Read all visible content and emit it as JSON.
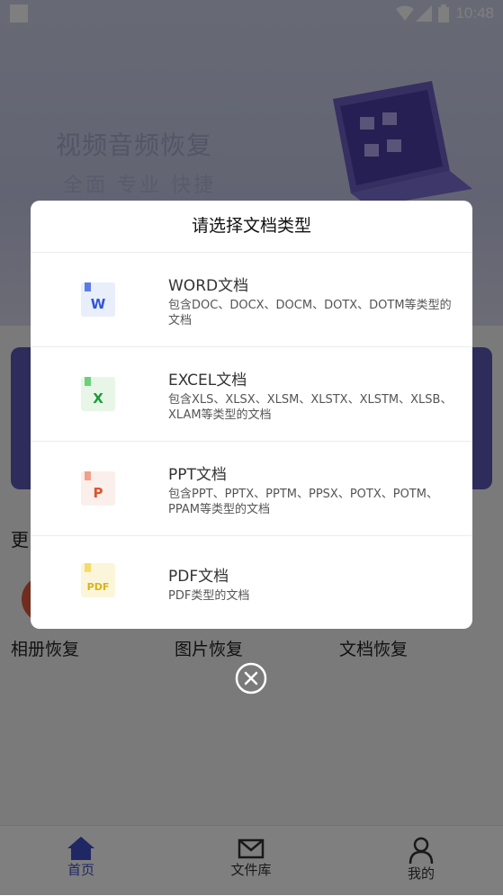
{
  "status_bar": {
    "time": "10:48"
  },
  "hero": {
    "title": "视频音频恢复",
    "subtitle": "全面  专业  快捷"
  },
  "section": {
    "more_label": "更"
  },
  "functions": [
    "相册恢复",
    "图片恢复",
    "文档恢复"
  ],
  "tabs": [
    {
      "label": "首页",
      "icon": "home-icon",
      "active": true
    },
    {
      "label": "文件库",
      "icon": "mail-icon",
      "active": false
    },
    {
      "label": "我的",
      "icon": "user-icon",
      "active": false
    }
  ],
  "dialog": {
    "title": "请选择文档类型",
    "options": [
      {
        "name": "WORD文档",
        "desc": "包含DOC、DOCX、DOCM、DOTX、DOTM等类型的文档",
        "icon_letter": "W",
        "icon": "word-file-icon",
        "icon_bg": "#e9eefb",
        "letter_color": "#2f56d8",
        "flag_color": "#5b7be6"
      },
      {
        "name": "EXCEL文档",
        "desc": "包含XLS、XLSX、XLSM、XLSTX、XLSTM、XLSB、XLAM等类型的文档",
        "icon_letter": "X",
        "icon": "excel-file-icon",
        "icon_bg": "#e8f6e8",
        "letter_color": "#1f9a3a",
        "flag_color": "#6cd07a"
      },
      {
        "name": "PPT文档",
        "desc": "包含PPT、PPTX、PPTM、PPSX、POTX、POTM、PPAM等类型的文档",
        "icon_letter": "P",
        "icon": "ppt-file-icon",
        "icon_bg": "#fbefec",
        "letter_color": "#e0532b",
        "flag_color": "#f0a08c"
      },
      {
        "name": "PDF文档",
        "desc": "PDF类型的文档",
        "icon_letter": "PDF",
        "icon": "pdf-file-icon",
        "icon_bg": "#fbf6d9",
        "letter_color": "#d9b21a",
        "flag_color": "#f2dc6a"
      }
    ]
  },
  "colors": {
    "accent": "#3f4ec9",
    "card": "#5b58b4"
  }
}
